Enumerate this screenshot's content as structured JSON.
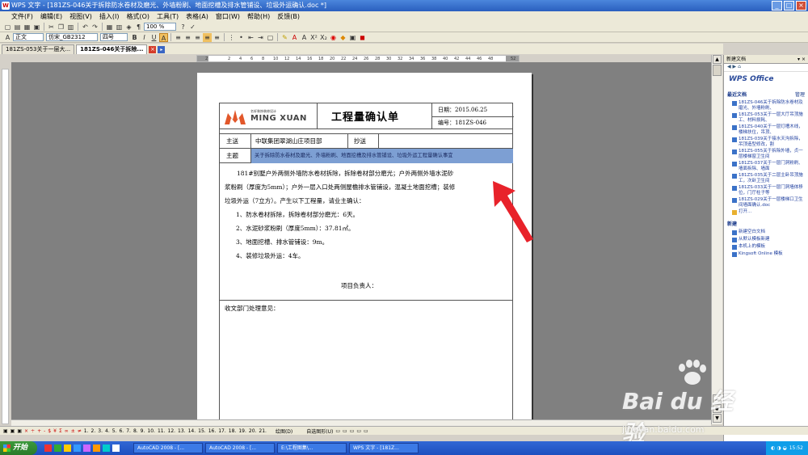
{
  "window": {
    "title": "WPS 文字 - [181ZS-046关于拆除防水卷材及磨光、外墙粉刷、地面挖槽及排水管铺设、垃圾外运确认.doc *]"
  },
  "menu": [
    "文件(F)",
    "编辑(E)",
    "视图(V)",
    "插入(I)",
    "格式(O)",
    "工具(T)",
    "表格(A)",
    "窗口(W)",
    "帮助(H)",
    "反馈(B)"
  ],
  "toolbar": {
    "zoom": "100 %",
    "style": "正文",
    "font": "仿宋_GB2312",
    "font_size": "四号"
  },
  "tabs": [
    {
      "label": "181ZS-053关于一层大..."
    },
    {
      "label": "181ZS-046关于拆除..."
    }
  ],
  "ruler": {
    "ticks": [
      "2",
      "",
      "2",
      "4",
      "6",
      "8",
      "10",
      "12",
      "14",
      "16",
      "18",
      "20",
      "22",
      "24",
      "26",
      "28",
      "30",
      "32",
      "34",
      "36",
      "38",
      "40",
      "42",
      "44",
      "46",
      "48",
      "",
      "52"
    ]
  },
  "document": {
    "logo_small": "名轩装饰装修设计",
    "logo_brand": "MING XUAN",
    "title": "工程量确认单",
    "date": "日期：2015.06.25",
    "number": "编号：181ZS-046",
    "send_to_label": "主送",
    "send_to_value": "中联集团翠湖山庄项目部",
    "cc_label": "抄送",
    "subject_label": "主题",
    "subject_value": "关于拆除防水卷材及磨光、外墙粉刷、地面挖槽及排水管铺设、垃圾外运工程量确认事宜",
    "body_lines": [
      "181#别墅户外两侧外墙防水卷材拆除，拆除卷材部分磨光；户外两侧外墙水泥砂",
      "浆粉刷（厚度为5mm）；户外一层入口处两侧屋檐排水管铺设，混凝土地面挖槽；装修",
      "垃圾外运（7立方）。产生以下工程量，请业主确认：",
      "1、防水卷材拆除，拆除卷材部分磨光：6天。",
      "2、水泥砂浆粉刷（厚度5mm）：37.81㎡。",
      "3、地面挖槽、排水管铺设：9m。",
      "4、装修垃圾外运：4车。"
    ],
    "project_lead": "项目负责人：",
    "receiving_opinion": "收文部门处理意见："
  },
  "taskpane": {
    "header": "新建文档",
    "brand": "WPS Office",
    "recent_label": "最近文档",
    "manage_label": "管理",
    "recent": [
      "181ZS-046关于拆除防水卷材及磨光、外墙粉刷、",
      "181ZS-053关于一层大厅吊顶施工、材料损耗、",
      "181ZS-040关于一层灯槽木线，楼梯扶位，吊顶、",
      "181ZS-039关于接水天沟拆除，吊顶造型修改，割",
      "181ZS-055关于拆除外墙，贞一层楼梯窗卫生间",
      "181ZS-037关于一层门洞粉刷、墙面拆除、墙面",
      "181ZS-035关于二层主卧吊顶施工，次卧卫生间",
      "181ZS-033关于一层门洞墙体移位，门厅柱子等",
      "181ZS-029关于一层楼梯口卫生间墙面确认.doc"
    ],
    "open_label": "打开...",
    "new_label": "新建",
    "new_items": [
      "新建空白文档",
      "从默认模板新建",
      "本机上的模板",
      "Kingsoft Online 模板"
    ]
  },
  "status": {
    "pages": [
      "1.",
      "2.",
      "3.",
      "4.",
      "5.",
      "6.",
      "7.",
      "8.",
      "9.",
      "10.",
      "11.",
      "12.",
      "13.",
      "14.",
      "15.",
      "16.",
      "17.",
      "18.",
      "19.",
      "20.",
      "21."
    ],
    "draw": "绘图(D)",
    "autoshape": "自选图形(U)"
  },
  "taskbar": {
    "start": "开始",
    "tasks": [
      "AutoCAD 2008 - [...",
      "AutoCAD 2008 - [...",
      "E:\\工程图集\\...",
      "WPS 文字 - [181Z..."
    ],
    "clock": "15:52"
  },
  "watermark": {
    "brand": "Bai du 经验",
    "url": "jingyan.baidu.com"
  },
  "colors": {
    "titlebar": "#2a5fbf",
    "highlight": "#7d9fd3",
    "arrow": "#e8222a"
  }
}
